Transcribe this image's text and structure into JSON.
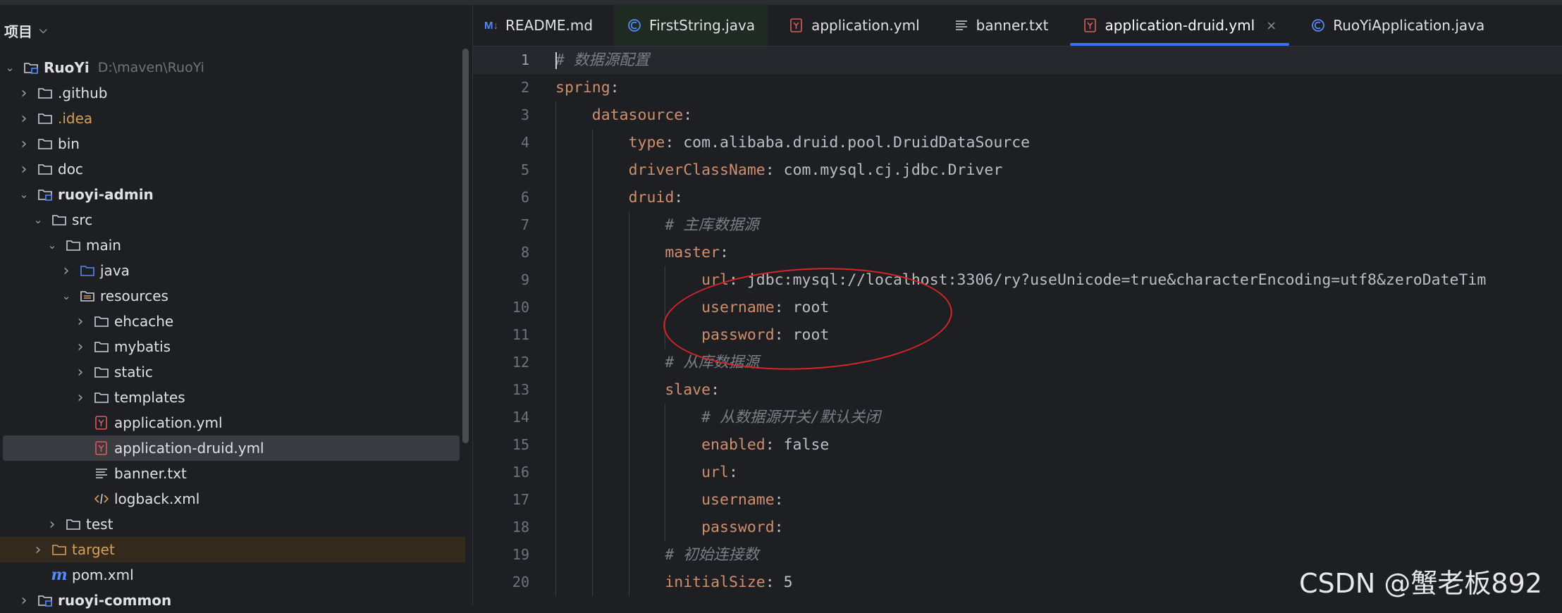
{
  "project_panel": {
    "title": "项目",
    "chevron_icon": "chevron-down-icon",
    "tree": [
      {
        "label": "RuoYi",
        "path": "D:\\maven\\RuoYi",
        "depth": 0,
        "expanded": true,
        "icon": "module-folder-icon",
        "bold": true
      },
      {
        "label": ".github",
        "depth": 1,
        "expanded": false,
        "icon": "folder-icon"
      },
      {
        "label": ".idea",
        "depth": 1,
        "expanded": false,
        "icon": "folder-icon",
        "orange": true
      },
      {
        "label": "bin",
        "depth": 1,
        "expanded": false,
        "icon": "folder-icon"
      },
      {
        "label": "doc",
        "depth": 1,
        "expanded": false,
        "icon": "folder-icon"
      },
      {
        "label": "ruoyi-admin",
        "depth": 1,
        "expanded": true,
        "icon": "module-folder-icon",
        "bold": true
      },
      {
        "label": "src",
        "depth": 2,
        "expanded": true,
        "icon": "folder-icon"
      },
      {
        "label": "main",
        "depth": 3,
        "expanded": true,
        "icon": "folder-icon"
      },
      {
        "label": "java",
        "depth": 4,
        "expanded": false,
        "icon": "source-folder-icon"
      },
      {
        "label": "resources",
        "depth": 4,
        "expanded": true,
        "icon": "resources-folder-icon"
      },
      {
        "label": "ehcache",
        "depth": 5,
        "expanded": false,
        "icon": "folder-icon"
      },
      {
        "label": "mybatis",
        "depth": 5,
        "expanded": false,
        "icon": "folder-icon"
      },
      {
        "label": "static",
        "depth": 5,
        "expanded": false,
        "icon": "folder-icon"
      },
      {
        "label": "templates",
        "depth": 5,
        "expanded": false,
        "icon": "folder-icon"
      },
      {
        "label": "application.yml",
        "depth": 5,
        "leaf": true,
        "icon": "yaml-file-icon"
      },
      {
        "label": "application-druid.yml",
        "depth": 5,
        "leaf": true,
        "icon": "yaml-file-icon",
        "selected": true
      },
      {
        "label": "banner.txt",
        "depth": 5,
        "leaf": true,
        "icon": "text-file-icon"
      },
      {
        "label": "logback.xml",
        "depth": 5,
        "leaf": true,
        "icon": "xml-file-icon"
      },
      {
        "label": "test",
        "depth": 3,
        "expanded": false,
        "icon": "folder-icon"
      },
      {
        "label": "target",
        "depth": 2,
        "expanded": false,
        "icon": "excluded-folder-icon",
        "orange": true,
        "excluded": true
      },
      {
        "label": "pom.xml",
        "depth": 2,
        "leaf": true,
        "icon": "maven-file-icon"
      },
      {
        "label": "ruoyi-common",
        "depth": 1,
        "expanded": false,
        "icon": "module-folder-icon",
        "bold": true
      }
    ]
  },
  "editor": {
    "tabs": [
      {
        "label": "README.md",
        "icon": "markdown-file-icon"
      },
      {
        "label": "FirstString.java",
        "icon": "java-class-icon",
        "highlight": true
      },
      {
        "label": "application.yml",
        "icon": "yaml-file-icon"
      },
      {
        "label": "banner.txt",
        "icon": "text-file-icon"
      },
      {
        "label": "application-druid.yml",
        "icon": "yaml-file-icon",
        "active": true,
        "closable": true
      },
      {
        "label": "RuoYiApplication.java",
        "icon": "java-class-icon"
      }
    ],
    "close_glyph": "×",
    "current_line": 1,
    "lines": [
      {
        "n": 1,
        "indent": 0,
        "comment": "# 数据源配置"
      },
      {
        "n": 2,
        "indent": 0,
        "key": "spring",
        "sep": ":"
      },
      {
        "n": 3,
        "indent": 1,
        "key": "datasource",
        "sep": ":"
      },
      {
        "n": 4,
        "indent": 2,
        "key": "type",
        "sep": ": ",
        "value": "com.alibaba.druid.pool.DruidDataSource"
      },
      {
        "n": 5,
        "indent": 2,
        "key": "driverClassName",
        "sep": ": ",
        "value": "com.mysql.cj.jdbc.Driver"
      },
      {
        "n": 6,
        "indent": 2,
        "key": "druid",
        "sep": ":"
      },
      {
        "n": 7,
        "indent": 3,
        "comment": "# 主库数据源"
      },
      {
        "n": 8,
        "indent": 3,
        "key": "master",
        "sep": ":"
      },
      {
        "n": 9,
        "indent": 4,
        "key": "url",
        "sep": ": ",
        "value": "jdbc:mysql://localhost:3306/ry?useUnicode=true&characterEncoding=utf8&zeroDateTim"
      },
      {
        "n": 10,
        "indent": 4,
        "key": "username",
        "sep": ": ",
        "value": "root"
      },
      {
        "n": 11,
        "indent": 4,
        "key": "password",
        "sep": ": ",
        "value": "root"
      },
      {
        "n": 12,
        "indent": 3,
        "comment": "# 从库数据源"
      },
      {
        "n": 13,
        "indent": 3,
        "key": "slave",
        "sep": ":"
      },
      {
        "n": 14,
        "indent": 4,
        "comment": "# 从数据源开关/默认关闭"
      },
      {
        "n": 15,
        "indent": 4,
        "key": "enabled",
        "sep": ": ",
        "value": "false"
      },
      {
        "n": 16,
        "indent": 4,
        "key": "url",
        "sep": ":"
      },
      {
        "n": 17,
        "indent": 4,
        "key": "username",
        "sep": ":"
      },
      {
        "n": 18,
        "indent": 4,
        "key": "password",
        "sep": ":"
      },
      {
        "n": 19,
        "indent": 3,
        "comment": "# 初始连接数"
      },
      {
        "n": 20,
        "indent": 3,
        "key": "initialSize",
        "sep": ": ",
        "value": "5"
      }
    ]
  },
  "watermark": "CSDN @蟹老板892",
  "colors": {
    "accent": "#3574f0",
    "yaml_key": "#cf8e6d",
    "comment": "#7a7e85",
    "annotation": "#d6262a"
  }
}
